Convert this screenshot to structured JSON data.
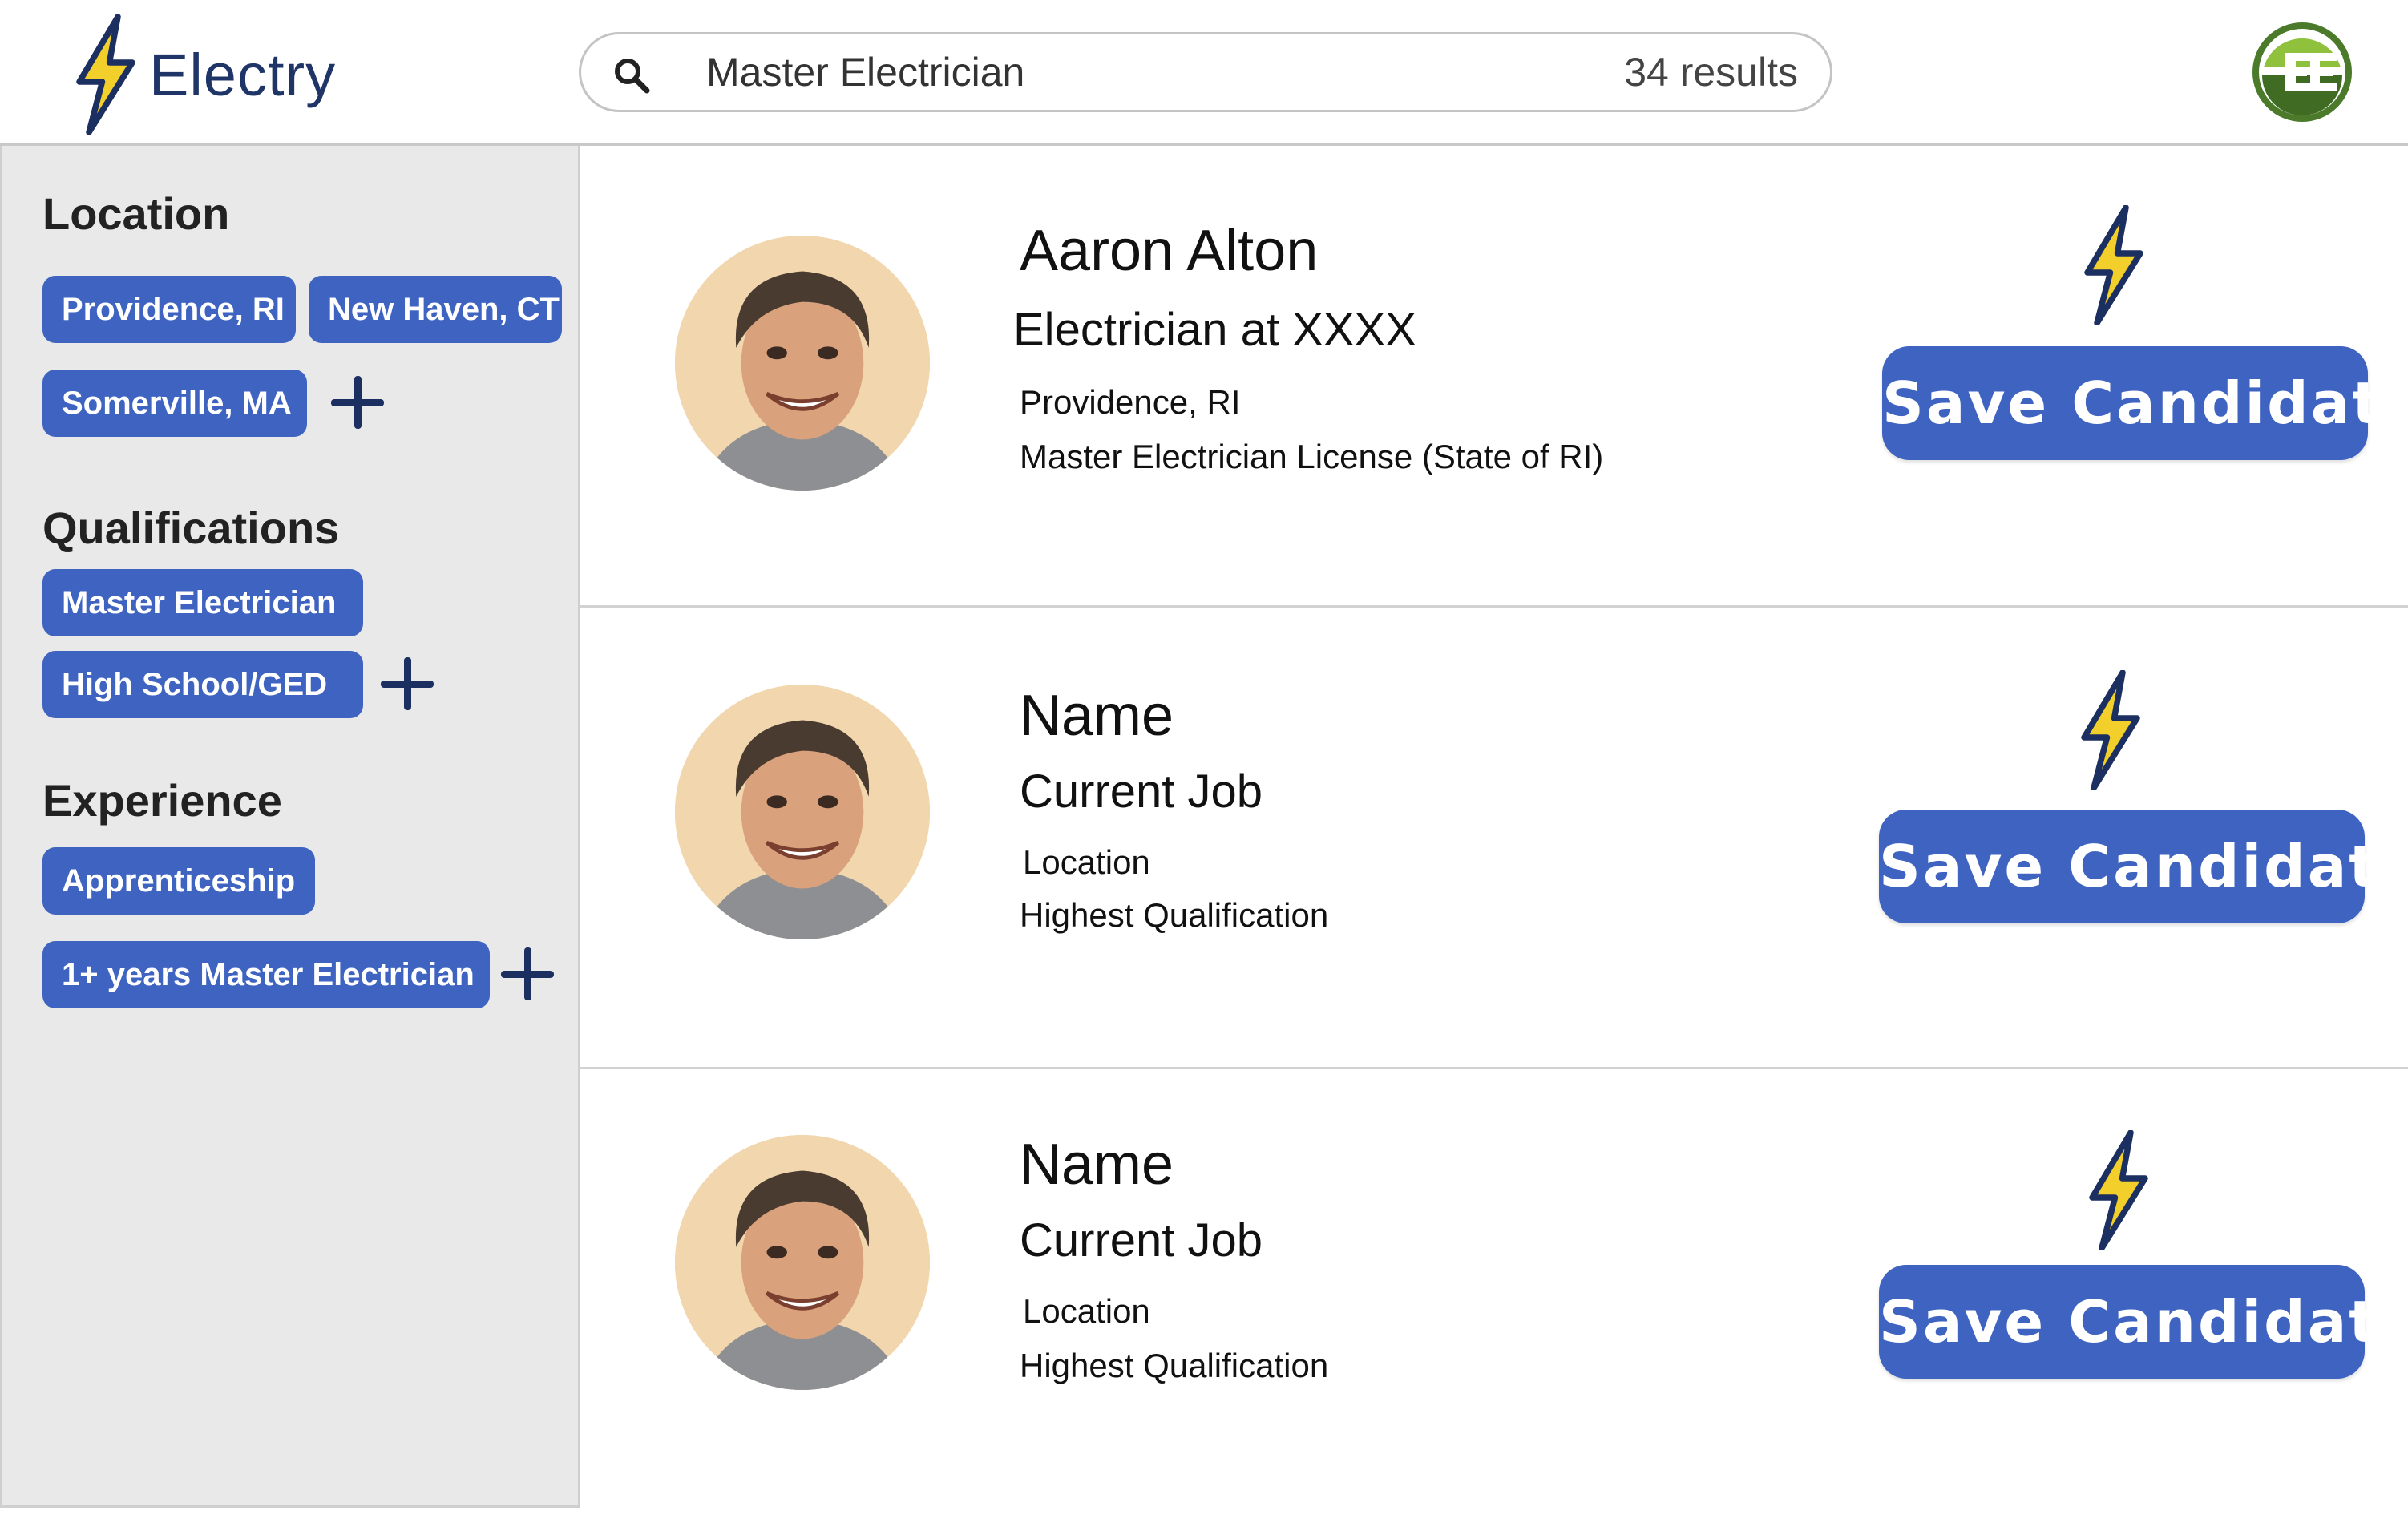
{
  "app": {
    "name": "Electry"
  },
  "search": {
    "query": "Master Electrician",
    "results": "34 results"
  },
  "filters": {
    "location": {
      "title": "Location",
      "chips": [
        "Providence, RI",
        "New Haven, CT",
        "Somerville, MA"
      ]
    },
    "qualifications": {
      "title": "Qualifications",
      "chips": [
        "Master Electrician",
        "High School/GED"
      ]
    },
    "experience": {
      "title": "Experience",
      "chips": [
        "Apprenticeship",
        "1+ years Master Electrician"
      ]
    }
  },
  "candidates": [
    {
      "name": "Aaron Alton",
      "job": "Electrician at XXXX",
      "location": "Providence, RI",
      "qualification": "Master Electrician License (State of RI)",
      "action": "Save Candidate"
    },
    {
      "name": "Name",
      "job": "Current Job",
      "location": "Location",
      "qualification": "Highest Qualification",
      "action": "Save Candidate"
    },
    {
      "name": "Name",
      "job": "Current Job",
      "location": "Location",
      "qualification": "Highest Qualification",
      "action": "Save Candidate"
    }
  ],
  "icons": {
    "brand": "lightning-bolt-icon",
    "search": "search-icon",
    "profile": "electry-logo-icon",
    "add": "plus-icon",
    "card": "lightning-bolt-icon"
  },
  "colors": {
    "accent": "#3e63c0",
    "brand_text": "#1f3568",
    "bolt_fill": "#f2cf2b",
    "bolt_stroke": "#1c2f61",
    "sidebar_bg": "#e9e9e9"
  }
}
